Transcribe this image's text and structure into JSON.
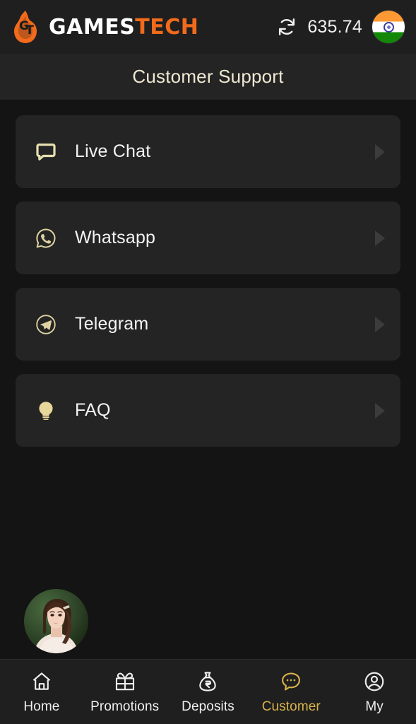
{
  "header": {
    "brand": {
      "name_white": "GAMES",
      "name_orange": "TECH",
      "logo_monogram": "GT",
      "logo_icon": "flame-logo-icon"
    },
    "refresh_icon": "refresh-icon",
    "balance": "635.74",
    "flag_icon": "india-flag-icon"
  },
  "page": {
    "title": "Customer Support"
  },
  "support": {
    "items": [
      {
        "label": "Live Chat",
        "icon": "chat-bubble-icon",
        "arrow": "chevron-right-icon"
      },
      {
        "label": "Whatsapp",
        "icon": "whatsapp-icon",
        "arrow": "chevron-right-icon"
      },
      {
        "label": "Telegram",
        "icon": "telegram-icon",
        "arrow": "chevron-right-icon"
      },
      {
        "label": "FAQ",
        "icon": "lightbulb-icon",
        "arrow": "chevron-right-icon"
      }
    ]
  },
  "float_widget": {
    "name": "support-agent-avatar"
  },
  "bottom_nav": {
    "items": [
      {
        "label": "Home",
        "icon": "home-icon",
        "active": false
      },
      {
        "label": "Promotions",
        "icon": "gift-icon",
        "active": false
      },
      {
        "label": "Deposits",
        "icon": "money-bag-rupee-icon",
        "active": false
      },
      {
        "label": "Customer",
        "icon": "chat-dots-icon",
        "active": true
      },
      {
        "label": "My",
        "icon": "user-circle-icon",
        "active": false
      }
    ]
  },
  "colors": {
    "page_bg": "#141414",
    "card_bg": "#242424",
    "header_bg": "#1f1f1f",
    "accent_gold": "#d8b34a",
    "icon_cream": "#e8dfb0",
    "brand_orange": "#f26a1b",
    "title_cream": "#efe8d2"
  }
}
